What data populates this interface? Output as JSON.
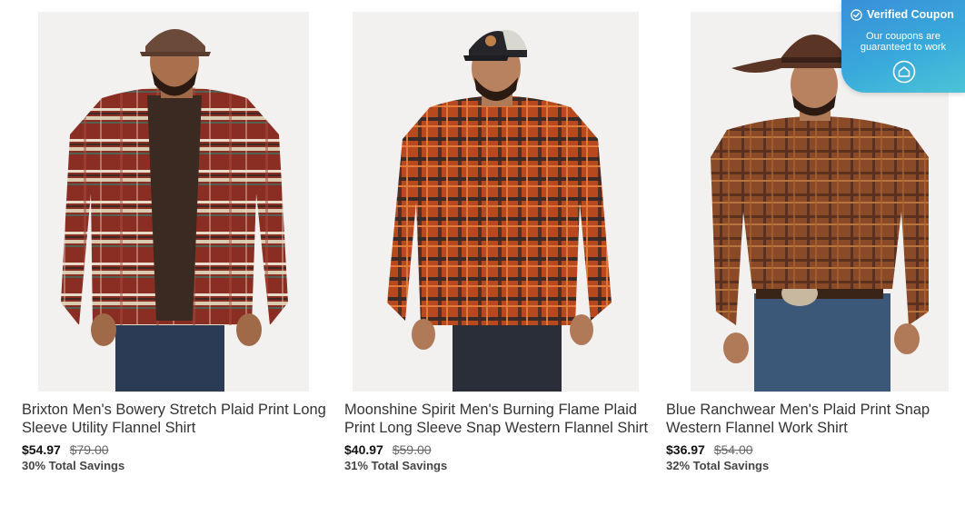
{
  "products": [
    {
      "title": "Brixton Men's Bowery Stretch Plaid Print Long Sleeve Utility Flannel Shirt",
      "price": "$54.97",
      "original_price": "$79.00",
      "savings": "30% Total Savings"
    },
    {
      "title": "Moonshine Spirit Men's Burning Flame Plaid Print Long Sleeve Snap Western Flannel Shirt",
      "price": "$40.97",
      "original_price": "$59.00",
      "savings": "31% Total Savings"
    },
    {
      "title": "Blue Ranchwear Men's Plaid Print Snap Western Flannel Work Shirt",
      "price": "$36.97",
      "original_price": "$54.00",
      "savings": "32% Total Savings"
    }
  ],
  "coupon_badge": {
    "title": "Verified Coupon",
    "subtitle_line1": "Our coupons are",
    "subtitle_line2": "guaranteed to work",
    "icon": "house-logo-icon"
  },
  "colors": {
    "coupon_gradient_start": "#3a8fd8",
    "coupon_gradient_end": "#4cc4d6"
  }
}
